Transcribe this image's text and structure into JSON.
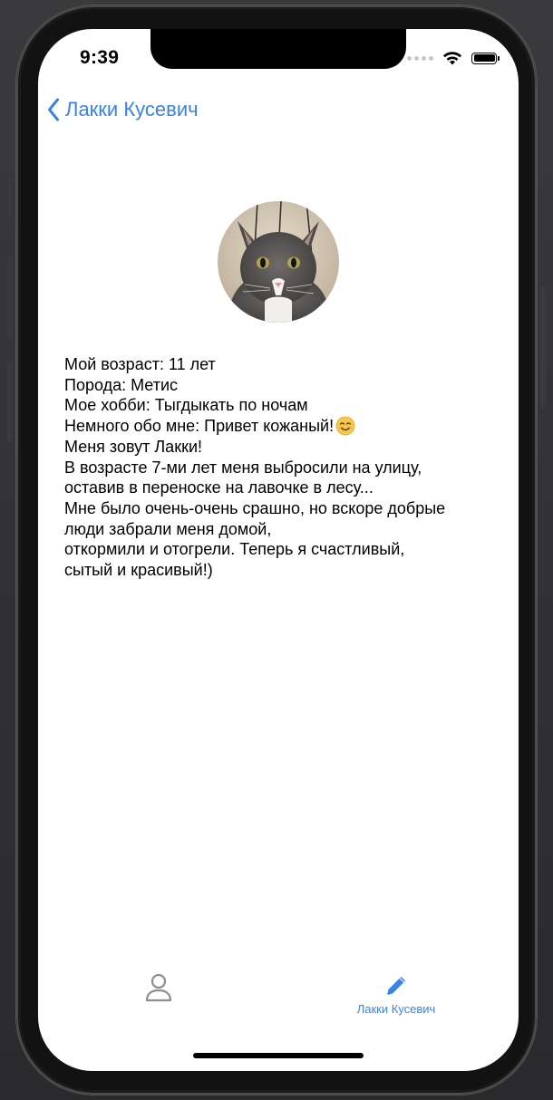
{
  "status_bar": {
    "time": "9:39"
  },
  "nav": {
    "back_label": "Лакки Кусевич",
    "back_icon": "chevron-left-icon"
  },
  "profile": {
    "avatar_icon": "cat-photo",
    "bio_lines": [
      "Мой возраст: 11 лет",
      "Порода: Метис",
      "Мое хобби: Тыгдыкать по ночам",
      "Немного обо мне: Привет кожаный!",
      "Меня зовут Лакки!",
      "В возрасте 7-ми лет меня выбросили на улицу,",
      "оставив в переноске на лавочке в лесу...",
      "Мне было очень-очень срашно, но вскоре добрые",
      "люди забрали меня домой,",
      "откормили и отогрели. Теперь я счастливый,",
      "сытый и красивый!)"
    ],
    "emoji": "smiling-face-emoji"
  },
  "tab_bar": {
    "items": [
      {
        "label": "",
        "icon": "person-icon",
        "active": false
      },
      {
        "label": "Лакки Кусевич",
        "icon": "pencil-icon",
        "active": true
      }
    ]
  },
  "colors": {
    "accent": "#3a82e8",
    "inactive_icon": "#8e8e93",
    "text": "#000000",
    "background": "#ffffff"
  }
}
